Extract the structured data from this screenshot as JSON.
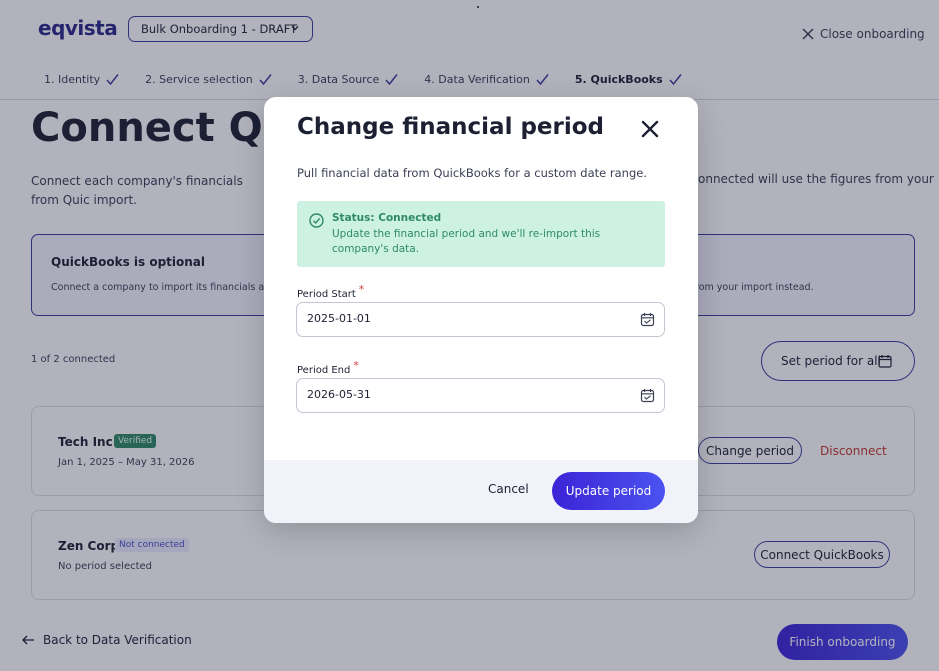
{
  "header": {
    "logo": "eqvista",
    "onboarding_select": "Bulk Onboarding 1 - DRAFT",
    "close_label": "Close onboarding"
  },
  "steps": [
    {
      "label": "1. Identity",
      "complete": true
    },
    {
      "label": "2. Service selection",
      "complete": true
    },
    {
      "label": "3. Data Source",
      "complete": true
    },
    {
      "label": "4. Data Verification",
      "complete": true
    },
    {
      "label": "5. QuickBooks",
      "complete": true,
      "active": true
    }
  ],
  "main": {
    "title": "Connect Quic",
    "intro_left": "Connect each company's financials from Quic import.",
    "intro_right": "onnected will use the figures from your",
    "info_title": "QuickBooks is optional",
    "info_desc_left": "Connect a company to import its financials and l",
    "info_desc_right": "rom your import instead.",
    "count": "1 of 2 connected",
    "set_period_label": "Set period for all"
  },
  "companies": [
    {
      "name": "Tech Inc",
      "badge": "Verified",
      "period": "Jan 1, 2025 – May 31, 2026",
      "action1": "Change period",
      "action2": "Disconnect"
    },
    {
      "name": "Zen Corp",
      "badge": "Not connected",
      "period": "No period selected",
      "action1": "Connect QuickBooks"
    }
  ],
  "footer": {
    "back_label": "Back to Data Verification",
    "finish_label": "Finish onboarding"
  },
  "modal": {
    "title": "Change financial period",
    "subtitle": "Pull financial data from QuickBooks for a custom date range.",
    "status_title": "Status: Connected",
    "status_message": "Update the financial period and we'll re-import this company's data.",
    "period_start_label": "Period Start",
    "period_start_value": "2025-01-01",
    "period_end_label": "Period End",
    "period_end_value": "2026-05-31",
    "required_mark": "*",
    "cancel_label": "Cancel",
    "update_label": "Update period"
  },
  "colors": {
    "accent": "#3b3f9e",
    "primary_button": "#4338e0",
    "success_bg": "#cdf2e3",
    "success_text": "#2e8a68",
    "danger": "#c0392b"
  },
  "icons": {
    "close": "close-icon",
    "check": "checkmark-icon",
    "calendar": "calendar-icon",
    "status": "check-circle-icon",
    "back": "arrow-left-icon",
    "dropdown": "chevron-down-icon"
  }
}
